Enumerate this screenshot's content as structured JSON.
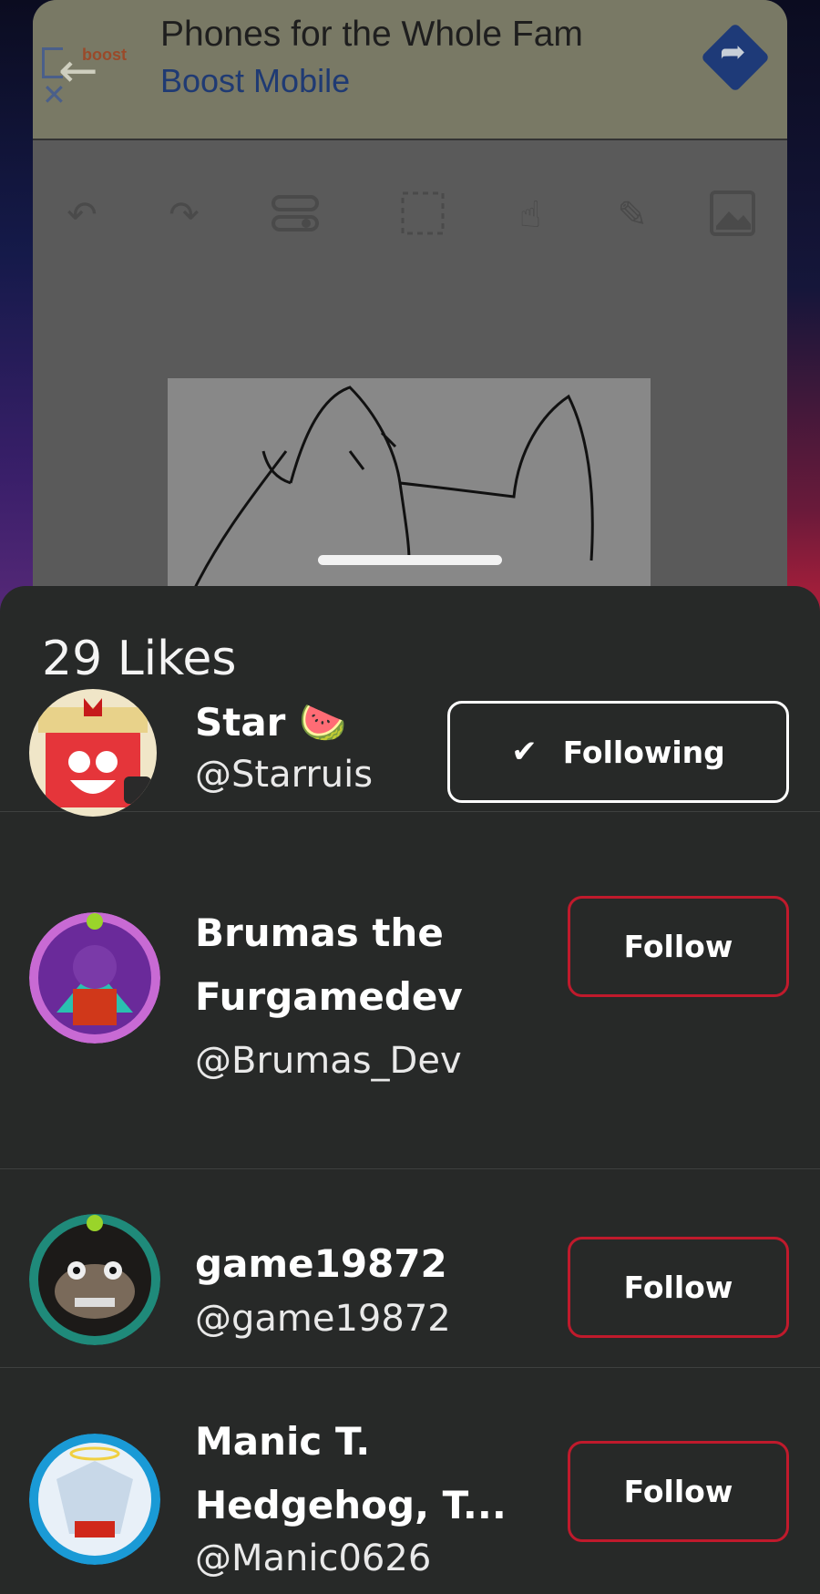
{
  "ad": {
    "brand_logo": "boost mobile",
    "title": "Phones for the Whole Fam",
    "brand": "Boost Mobile",
    "back_icon": "back-arrow-icon",
    "close_icon": "close-icon",
    "go_icon": "directions-arrow-icon"
  },
  "toolbar": {
    "icons": [
      "undo-icon",
      "redo-icon",
      "layers-toggle-icon",
      "select-icon",
      "hand-icon",
      "pencil-icon",
      "image-icon"
    ]
  },
  "likes": {
    "title": "29 Likes",
    "users": [
      {
        "name_line1": "Star 🍉",
        "name_line2": "",
        "handle": "@Starruis",
        "button": "Following",
        "following": true,
        "accent": "#e5353a"
      },
      {
        "name_line1": "Brumas the",
        "name_line2": "Furgamedev",
        "handle": "@Brumas_Dev",
        "button": "Follow",
        "following": false,
        "accent": "#8e44ad"
      },
      {
        "name_line1": "game19872",
        "name_line2": "",
        "handle": "@game19872",
        "button": "Follow",
        "following": false,
        "accent": "#1f8a7a"
      },
      {
        "name_line1": "Manic T.",
        "name_line2": "Hedgehog, T...",
        "handle": "@Manic0626",
        "button": "Follow",
        "following": false,
        "accent": "#1a9ad6"
      }
    ]
  },
  "colors": {
    "sheet_bg": "#272928",
    "follow_border": "#c01a2c",
    "following_border": "#ffffff"
  }
}
